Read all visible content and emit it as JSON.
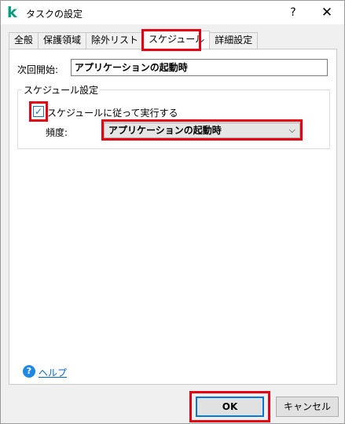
{
  "window": {
    "title": "タスクの設定",
    "help_glyph": "?",
    "close_glyph": "✕",
    "app_glyph": "k"
  },
  "tabs": [
    {
      "label": "全般"
    },
    {
      "label": "保護領域"
    },
    {
      "label": "除外リスト"
    },
    {
      "label": "スケジュール",
      "active": true
    },
    {
      "label": "詳細設定"
    }
  ],
  "schedule": {
    "next_start_label": "次回開始:",
    "next_start_value": "アプリケーションの起動時",
    "group_title": "スケジュール設定",
    "checkbox_label": "スケジュールに従って実行する",
    "checkbox_checked": true,
    "frequency_label": "頻度:",
    "frequency_value": "アプリケーションの起動時"
  },
  "help": {
    "label": "ヘルプ"
  },
  "buttons": {
    "ok": "OK",
    "cancel": "キャンセル"
  },
  "colors": {
    "highlight": "#e60012",
    "accent": "#0078d7",
    "brand": "#009e7f"
  },
  "icons": {
    "app": "kaspersky-icon",
    "help": "question-circle-icon",
    "dropdown": "chevron-down-icon",
    "check": "checkmark-icon"
  }
}
